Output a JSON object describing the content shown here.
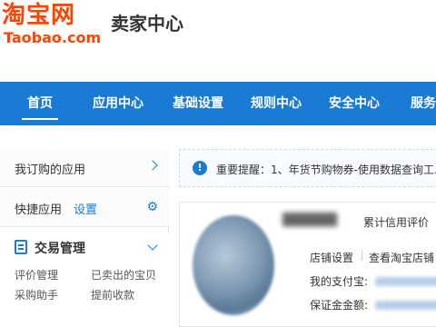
{
  "header": {
    "logo_cn": "淘宝网",
    "logo_en": "Taobao.com",
    "title": "卖家中心"
  },
  "nav": {
    "items": [
      {
        "label": "首页",
        "active": true
      },
      {
        "label": "应用中心"
      },
      {
        "label": "基础设置"
      },
      {
        "label": "规则中心"
      },
      {
        "label": "安全中心"
      },
      {
        "label": "服务"
      }
    ]
  },
  "sidebar": {
    "my_apps": "我订购的应用",
    "quick_apps": "快捷应用",
    "quick_settings": "设置",
    "trade": {
      "title": "交易管理",
      "links": [
        "评价管理",
        "已卖出的宝贝",
        "采购助手",
        "提前收款"
      ]
    }
  },
  "notice": {
    "icon": "!",
    "text": "重要提醒：1、年货节购物券-使用数据查询工..."
  },
  "profile": {
    "credit_label": "累计信用评价",
    "shop_settings": "店铺设置",
    "view_shop": "查看淘宝店铺",
    "alipay_label": "我的支付宝:",
    "deposit_label": "保证金金额:"
  },
  "colors": {
    "accent": "#1a7bd4",
    "brand": "#ff4400"
  }
}
